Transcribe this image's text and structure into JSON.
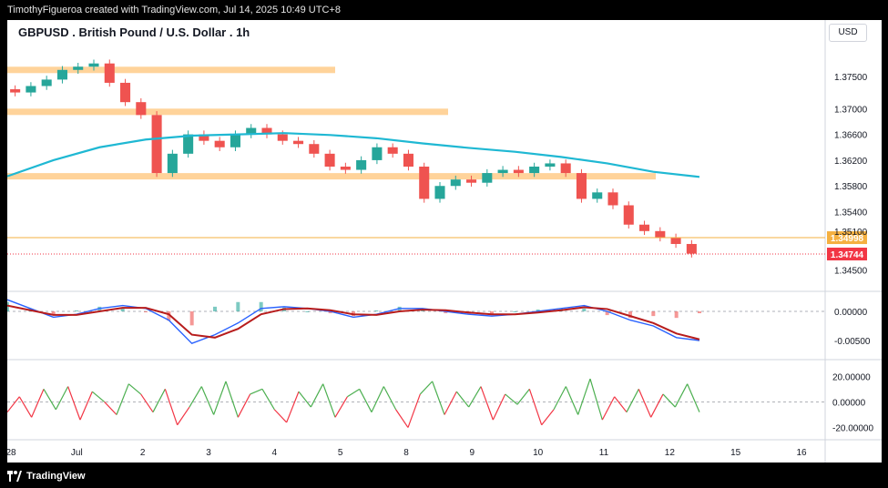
{
  "header": {
    "credit": "TimothyFigueroa created with TradingView.com, Jul 14, 2025 10:49 UTC+8"
  },
  "footer": {
    "brand": "TradingView"
  },
  "currency_button": "USD",
  "colors": {
    "up": "#26a69a",
    "down": "#ef5350",
    "ema": "#1fb8d3",
    "zone": "#ffd39a",
    "macd": "#2962ff",
    "signal": "#b71c1c",
    "rsi_up": "#4caf50",
    "rsi_down": "#f23645",
    "last_price": "#f23645",
    "level_line": "#f5b041"
  },
  "chart_data": [
    {
      "type": "candlestick",
      "title": "GBPUSD . British Pound / U.S. Dollar . 1h",
      "x_ticks": [
        "28",
        "Jul",
        "2",
        "3",
        "4",
        "5",
        "8",
        "9",
        "10",
        "11",
        "12",
        "15",
        "16"
      ],
      "y_ticks": [
        "1.37500",
        "1.37000",
        "1.36600",
        "1.36200",
        "1.35800",
        "1.35400",
        "1.35100",
        "1.34500"
      ],
      "ylim": [
        1.3425,
        1.3795
      ],
      "price_labels": [
        {
          "value": "1.34998",
          "color": "#f5b041"
        },
        {
          "value": "1.34744",
          "color": "#f23645"
        }
      ],
      "last_price": 1.34744,
      "level_line": 1.34998,
      "zones": [
        1.376,
        1.3695,
        1.3595
      ],
      "ema_series": [
        1.3595,
        1.362,
        1.364,
        1.3652,
        1.3658,
        1.366,
        1.3662,
        1.3659,
        1.3654,
        1.3646,
        1.3639,
        1.3633,
        1.3625,
        1.3615,
        1.3602,
        1.3594
      ],
      "candle_closes": [
        1.3725,
        1.3735,
        1.3745,
        1.376,
        1.3765,
        1.377,
        1.374,
        1.371,
        1.369,
        1.36,
        1.363,
        1.366,
        1.365,
        1.364,
        1.366,
        1.367,
        1.366,
        1.365,
        1.3645,
        1.363,
        1.361,
        1.3605,
        1.362,
        1.364,
        1.363,
        1.361,
        1.356,
        1.358,
        1.359,
        1.3585,
        1.36,
        1.3605,
        1.36,
        1.361,
        1.3615,
        1.36,
        1.356,
        1.357,
        1.355,
        1.352,
        1.351,
        1.35,
        1.349,
        1.3475
      ]
    },
    {
      "type": "line",
      "name": "MACD",
      "y_ticks": [
        "0.00000",
        "-0.00500"
      ],
      "ylim": [
        -0.0075,
        0.0025
      ],
      "macd": [
        0.002,
        0.0005,
        -0.001,
        -0.0005,
        0.0005,
        0.001,
        0.0005,
        -0.0015,
        -0.0055,
        -0.004,
        -0.002,
        0.0005,
        0.0008,
        0.0005,
        0.0,
        -0.001,
        -0.0005,
        0.0005,
        0.0005,
        0.0,
        -0.0005,
        -0.0008,
        -0.0005,
        0.0,
        0.0005,
        0.001,
        0.0,
        -0.0015,
        -0.0025,
        -0.0045,
        -0.005
      ],
      "signal": [
        0.001,
        0.0002,
        -0.0006,
        -0.0006,
        0.0,
        0.0006,
        0.0006,
        -0.0005,
        -0.004,
        -0.0045,
        -0.003,
        -0.0005,
        0.0004,
        0.0005,
        0.0002,
        -0.0005,
        -0.0006,
        0.0,
        0.0003,
        0.0002,
        -0.0002,
        -0.0005,
        -0.0005,
        -0.0002,
        0.0002,
        0.0007,
        0.0004,
        -0.0008,
        -0.002,
        -0.0038,
        -0.0048
      ]
    },
    {
      "type": "line",
      "name": "RSI-style oscillator",
      "y_ticks": [
        "20.00000",
        "0.00000",
        "-20.00000"
      ],
      "ylim": [
        -26,
        28
      ],
      "values": [
        -8,
        4,
        -12,
        10,
        -6,
        12,
        -14,
        8,
        0,
        -10,
        14,
        6,
        -8,
        10,
        -18,
        -4,
        12,
        -10,
        16,
        -12,
        6,
        10,
        -6,
        -16,
        8,
        -4,
        14,
        -12,
        4,
        10,
        -8,
        12,
        -6,
        -20,
        6,
        16,
        -10,
        8,
        -4,
        12,
        -14,
        6,
        -2,
        10,
        -18,
        -6,
        12,
        -10,
        18,
        -14,
        4,
        -8,
        10,
        -12,
        6,
        -4,
        14,
        -8
      ]
    }
  ]
}
